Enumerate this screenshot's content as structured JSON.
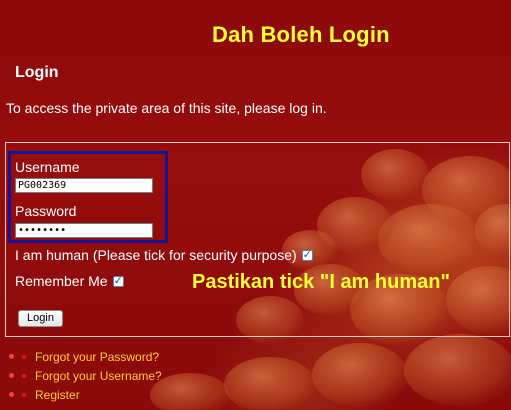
{
  "annotations": {
    "title": "Dah Boleh Login",
    "tip": "Pastikan tick \"I am human\""
  },
  "page": {
    "title": "Login",
    "intro": "To access the private area of this site, please log in."
  },
  "form": {
    "username_label": "Username",
    "username_value": "PG002369",
    "password_label": "Password",
    "password_value": "12345678",
    "human_label": "I am human (Please tick for security purpose)",
    "human_checked": true,
    "remember_label": "Remember Me",
    "remember_checked": true,
    "login_button": "Login"
  },
  "links": [
    {
      "label": "Forgot your Password?"
    },
    {
      "label": "Forgot your Username?"
    },
    {
      "label": "Register"
    }
  ],
  "colors": {
    "background": "#8c0a0a",
    "annotation": "#ffff33",
    "highlight_border": "#14149a",
    "link": "#ffcc33",
    "bullet": "#ff3b3b"
  },
  "icons": {
    "checkbox_tick": "checkmark-icon",
    "list_bullet": "bullet-icon"
  }
}
